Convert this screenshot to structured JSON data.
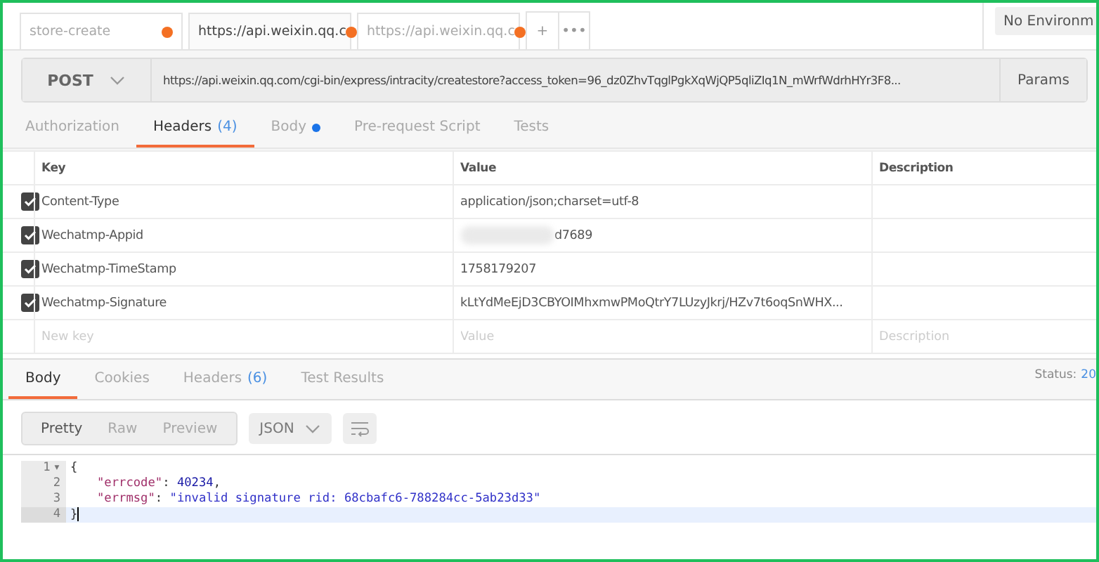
{
  "tabs": [
    {
      "label": "store-create",
      "selected": false,
      "unsaved": true
    },
    {
      "label": "https://api.weixin.qq.c",
      "selected": true,
      "unsaved": true
    },
    {
      "label": "https://api.weixin.qq.c",
      "selected": false,
      "unsaved": true
    }
  ],
  "tab_actions": [
    "+",
    "•••"
  ],
  "environment": "No Environm",
  "request": {
    "method": "POST",
    "url": "https://api.weixin.qq.com/cgi-bin/express/intracity/createstore?access_token=96_dz0ZhvTqglPgkXqWjQP5qliZIq1N_mWrfWdrhHYr3F8...",
    "params_button": "Params"
  },
  "request_tabs": [
    {
      "label": "Authorization",
      "selected": false
    },
    {
      "label": "Headers",
      "count": "(4)",
      "selected": true
    },
    {
      "label": "Body",
      "has_content": true,
      "selected": false
    },
    {
      "label": "Pre-request Script",
      "selected": false
    },
    {
      "label": "Tests",
      "selected": false
    }
  ],
  "headers_table": {
    "columns": [
      "Key",
      "Value",
      "Description"
    ],
    "rows": [
      {
        "checked": true,
        "key": "Content-Type",
        "value": "application/json;charset=utf-8",
        "redacted": false
      },
      {
        "checked": true,
        "key": "Wechatmp-Appid",
        "value": "d7689",
        "redacted": true
      },
      {
        "checked": true,
        "key": "Wechatmp-TimeStamp",
        "value": "1758179207",
        "redacted": false
      },
      {
        "checked": true,
        "key": "Wechatmp-Signature",
        "value": "kLtYdMeEjD3CBYOIMhxmwPMoQtrY7LUzyJkrj/HZv7t6oqSnWHX...",
        "redacted": false
      }
    ],
    "new_row": [
      {
        "placeholder": "New key"
      },
      {
        "placeholder": "Value"
      },
      {
        "placeholder": "Description"
      }
    ]
  },
  "response": {
    "tabs": [
      {
        "label": "Body",
        "selected": true
      },
      {
        "label": "Cookies",
        "selected": false
      },
      {
        "label": "Headers",
        "count": "(6)",
        "selected": false
      },
      {
        "label": "Test Results",
        "selected": false
      }
    ],
    "status_label": "Status:",
    "status_value": "20",
    "view_modes": [
      {
        "label": "Pretty",
        "selected": true
      },
      {
        "label": "Raw",
        "selected": false
      },
      {
        "label": "Preview",
        "selected": false
      }
    ],
    "format": "JSON",
    "code": [
      {
        "number": "1",
        "fold": "▾",
        "indented": false,
        "active": false,
        "tokens": [
          {
            "kind": "punct",
            "text": "{"
          }
        ]
      },
      {
        "number": "2",
        "indented": true,
        "active": false,
        "tokens": [
          {
            "kind": "key",
            "text": "\"errcode\""
          },
          {
            "kind": "punct",
            "text": ": "
          },
          {
            "kind": "number",
            "text": "40234"
          },
          {
            "kind": "punct",
            "text": ","
          }
        ]
      },
      {
        "number": "3",
        "indented": true,
        "active": false,
        "tokens": [
          {
            "kind": "key",
            "text": "\"errmsg\""
          },
          {
            "kind": "punct",
            "text": ": "
          },
          {
            "kind": "string",
            "text": "\"invalid signature rid: 68cbafc6-788284cc-5ab23d33\""
          }
        ]
      },
      {
        "number": "4",
        "indented": false,
        "active": true,
        "tokens": [
          {
            "kind": "punct",
            "text": "}"
          }
        ]
      }
    ]
  }
}
